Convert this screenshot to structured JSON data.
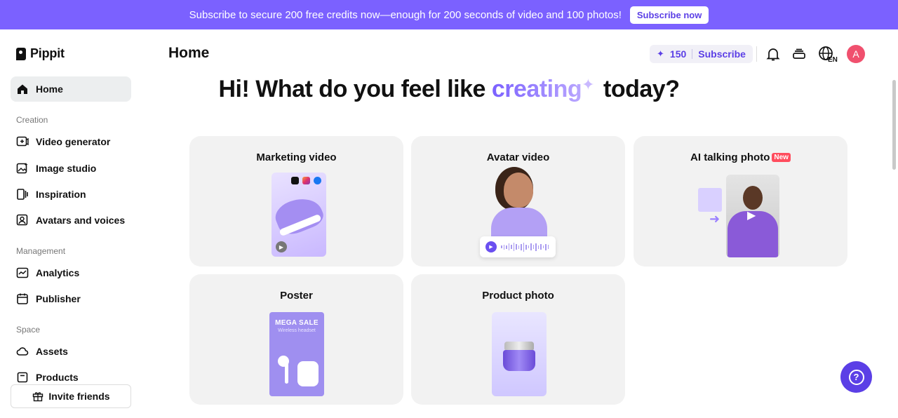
{
  "banner": {
    "text": "Subscribe to secure 200 free credits now—enough for 200 seconds of video and 100 photos!",
    "button_label": "Subscribe now"
  },
  "app": {
    "name": "Pippit"
  },
  "sidebar": {
    "home": "Home",
    "sections": [
      {
        "label": "Creation",
        "items": [
          "Video generator",
          "Image studio",
          "Inspiration",
          "Avatars and voices"
        ]
      },
      {
        "label": "Management",
        "items": [
          "Analytics",
          "Publisher"
        ]
      },
      {
        "label": "Space",
        "items": [
          "Assets",
          "Products"
        ]
      }
    ],
    "invite_label": "Invite friends"
  },
  "header": {
    "title": "Home",
    "credits": "150",
    "subscribe_label": "Subscribe",
    "language": "EN",
    "avatar_initial": "A"
  },
  "hero": {
    "prefix": "Hi! What do you feel like ",
    "accent": "creating",
    "suffix": " today?"
  },
  "cards": {
    "marketing": {
      "title": "Marketing video"
    },
    "avatar": {
      "title": "Avatar video"
    },
    "talking": {
      "title": "AI talking photo",
      "badge": "New"
    },
    "poster": {
      "title": "Poster",
      "headline": "MEGA SALE",
      "subline": "Wireless headset"
    },
    "product": {
      "title": "Product photo"
    }
  },
  "colors": {
    "brand": "#7b61ff",
    "brand_dark": "#5b3fe6",
    "card_bg": "#f2f2f2",
    "badge_new": "#ff4d5e"
  },
  "icons": {
    "home": "home-icon",
    "video_generator": "video-plus-icon",
    "image_studio": "image-sparkle-icon",
    "inspiration": "inspiration-icon",
    "avatars": "avatar-icon",
    "analytics": "chart-icon",
    "publisher": "calendar-icon",
    "assets": "cloud-icon",
    "products": "box-icon",
    "invite": "gift-icon",
    "notifications": "bell-icon",
    "inbox": "stack-icon",
    "language": "globe-icon",
    "help": "help-icon"
  }
}
